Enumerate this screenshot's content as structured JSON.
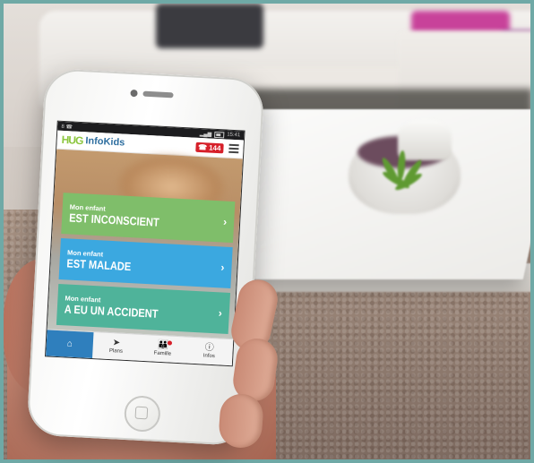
{
  "app": {
    "logo_text": "HUG",
    "title": "InfoKids",
    "call_number": "144"
  },
  "status_bar": {
    "time": "15:41",
    "carrier": "8 ☎"
  },
  "cards": [
    {
      "prefix": "Mon enfant",
      "label": "EST INCONSCIENT",
      "color": "#7fbe6a"
    },
    {
      "prefix": "Mon enfant",
      "label": "EST MALADE",
      "color": "#3ba8e0"
    },
    {
      "prefix": "Mon enfant",
      "label": "A EU UN ACCIDENT",
      "color": "#4fb39a"
    }
  ],
  "tabs": [
    {
      "label": "",
      "icon": "home-icon",
      "active": true
    },
    {
      "label": "Plans",
      "icon": "navigation-arrow-icon"
    },
    {
      "label": "Famille",
      "icon": "family-icon"
    },
    {
      "label": "Infos",
      "icon": "info-icon"
    }
  ],
  "colors": {
    "accent_blue": "#2f7fbd",
    "emergency_red": "#d6202a",
    "logo_green": "#8cc63f"
  }
}
